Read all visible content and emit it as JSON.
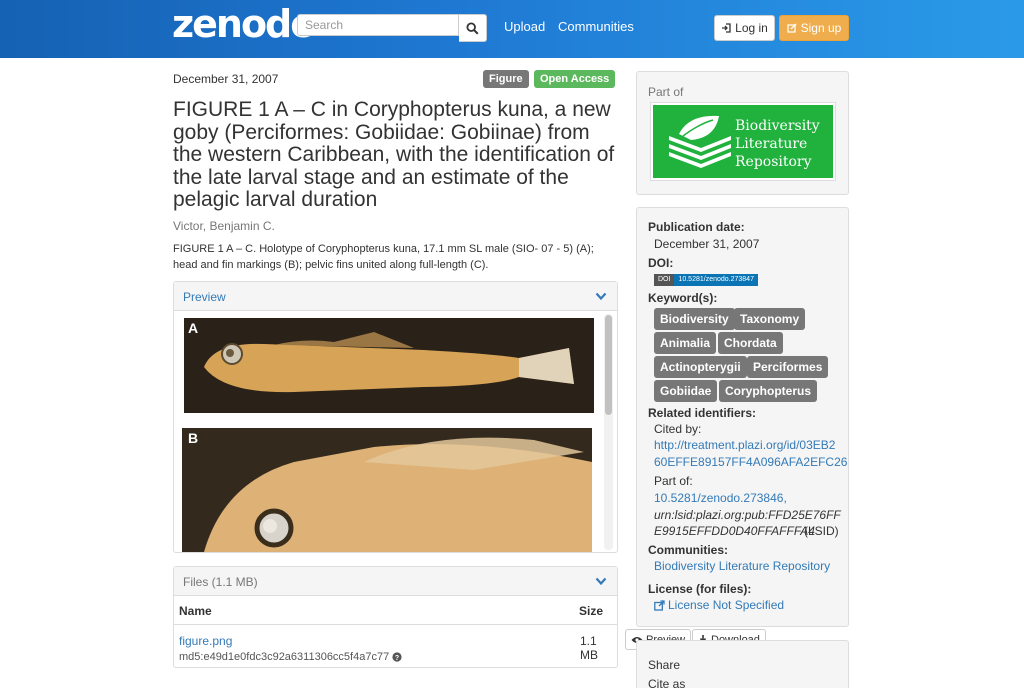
{
  "header": {
    "logo": "zenodo",
    "search_placeholder": "Search",
    "nav": [
      "Upload",
      "Communities"
    ],
    "login_label": "Log in",
    "signup_label": "Sign up"
  },
  "record": {
    "date": "December 31, 2007",
    "labels": [
      "Figure",
      "Open Access"
    ],
    "title": "FIGURE 1 A – C in Coryphopterus kuna, a new goby (Perciformes: Gobiidae: Gobiinae) from the western Caribbean, with the identification of the late larval stage and an estimate of the pelagic larval duration",
    "author": "Victor, Benjamin C.",
    "description": "FIGURE 1 A – C. Holotype of Coryphopterus kuna, 17.1 mm SL male (SIO- 07 - 5) (A); head and fin markings (B); pelvic fins united along full-length (C)."
  },
  "preview": {
    "heading": "Preview",
    "panel_labels": [
      "A",
      "B"
    ]
  },
  "files": {
    "heading": "Files (1.1 MB)",
    "col_name": "Name",
    "col_size": "Size",
    "rows": [
      {
        "name": "figure.png",
        "md5": "md5:e49d1e0fdc3c92a6311306cc5f4a7c77",
        "size": "1.1 MB"
      }
    ],
    "preview_button": "Preview",
    "download_button": "Download"
  },
  "sidebar": {
    "part_of_label": "Part of",
    "community_logo_text": "Biodiversity Literature Repository",
    "publication_date_label": "Publication date:",
    "publication_date": "December 31, 2007",
    "doi_label": "DOI:",
    "doi_badge_left": "DOI",
    "doi_badge_right": "10.5281/zenodo.273847",
    "keywords_label": "Keyword(s):",
    "keywords": [
      "Biodiversity",
      "Taxonomy",
      "Animalia",
      "Chordata",
      "Actinopterygii",
      "Perciformes",
      "Gobiidae",
      "Coryphopterus"
    ],
    "related_label": "Related identifiers:",
    "cited_by_label": "Cited by:",
    "cited_by_line1": "http://treatment.plazi.org/id/03EB2",
    "cited_by_line2": "60EFFE89157FF4A096AFA2EFC26",
    "part_of_ids_label": "Part of:",
    "part_of_doi": "10.5281/zenodo.273846,",
    "part_of_lsid_line1": "urn:lsid:plazi.org:pub:FFD25E76FF",
    "part_of_lsid_line2": "E9915EFFDD0D40FFAFFFA4",
    "part_of_lsid_suffix": "(LSID)",
    "communities_label": "Communities:",
    "community": "Biodiversity Literature Repository",
    "license_label": "License (for files):",
    "license": "License Not Specified",
    "share_label": "Share",
    "cite_as_label": "Cite as"
  },
  "colors": {
    "header_start": "#1561b3",
    "header_end": "#2a9ae8",
    "link": "#337ab7",
    "open_access": "#5cb85c",
    "signup": "#f0ad4e",
    "community_logo": "#20b23d"
  }
}
